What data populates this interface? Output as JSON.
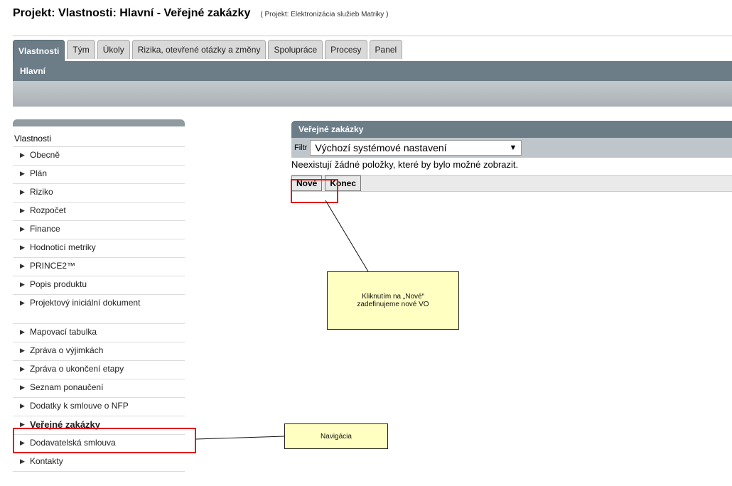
{
  "header": {
    "title": "Projekt: Vlastnosti: Hlavní - Veřejné zakázky",
    "subtitle": "( Projekt: Elektronizácia služieb Matriky )"
  },
  "tabs": [
    {
      "label": "Vlastnosti",
      "active": true
    },
    {
      "label": "Tým"
    },
    {
      "label": "Úkoly"
    },
    {
      "label": "Rizika, otevřené otázky a změny"
    },
    {
      "label": "Spolupráce"
    },
    {
      "label": "Procesy"
    },
    {
      "label": "Panel"
    }
  ],
  "subnav": {
    "label": "Hlavní"
  },
  "sidebar": {
    "header": "Vlastnosti",
    "items": [
      {
        "label": "Obecně"
      },
      {
        "label": "Plán"
      },
      {
        "label": "Riziko"
      },
      {
        "label": "Rozpočet"
      },
      {
        "label": "Finance"
      },
      {
        "label": "Hodnoticí metriky"
      },
      {
        "label": "PRINCE2™"
      },
      {
        "label": "Popis produktu"
      },
      {
        "label": "Projektový iniciální dokument"
      },
      {
        "label": "Mapovací tabulka"
      },
      {
        "label": "Zpráva o výjimkách"
      },
      {
        "label": "Zpráva o ukončení etapy"
      },
      {
        "label": "Seznam ponaučení"
      },
      {
        "label": "Dodatky k smlouve o NFP"
      },
      {
        "label": "Veřejné zakázky",
        "selected": true
      },
      {
        "label": "Dodavatelská smlouva"
      },
      {
        "label": "Kontakty"
      }
    ]
  },
  "panel": {
    "title": "Veřejné zakázky",
    "filter_label": "Filtr",
    "filter_value": "Výchozí systémové nastavení",
    "empty_message": "Neexistují žádné položky, které by bylo možné zobrazit.",
    "new_button": "Nové",
    "end_button": "Konec"
  },
  "annotations": {
    "callout_new": "Kliknutím na „Nové“ zadefinujeme nové VO",
    "callout_nav": "Navigácia",
    "highlight_color": "#e3161a",
    "callout_color": "#ffffc2"
  }
}
